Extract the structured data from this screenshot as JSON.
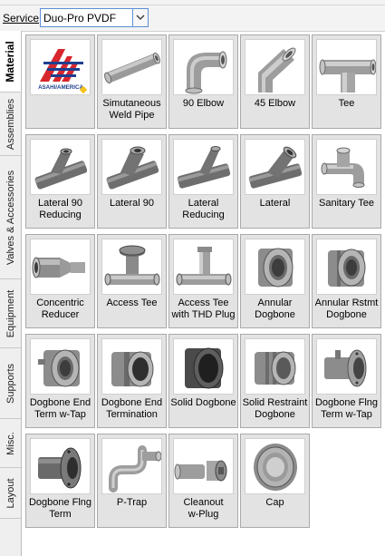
{
  "service": {
    "label": "Service",
    "value": "Duo-Pro PVDF"
  },
  "tabs": [
    "Material",
    "Assemblies",
    "Valves & Accessories",
    "Equipment",
    "Supports",
    "Misc.",
    "Layout"
  ],
  "logo": {
    "text": "ASAHI/AMERICA"
  },
  "items": [
    {
      "label": "",
      "icon": "asahi-america-logo"
    },
    {
      "label": "Simutaneous\nWeld Pipe",
      "icon": "pipe-icon"
    },
    {
      "label": "90 Elbow",
      "icon": "elbow-90-icon"
    },
    {
      "label": "45 Elbow",
      "icon": "elbow-45-icon"
    },
    {
      "label": "Tee",
      "icon": "tee-icon"
    },
    {
      "label": "Lateral 90\nReducing",
      "icon": "lateral-90-reducing-icon"
    },
    {
      "label": "Lateral 90",
      "icon": "lateral-90-icon"
    },
    {
      "label": "Lateral\nReducing",
      "icon": "lateral-reducing-icon"
    },
    {
      "label": "Lateral",
      "icon": "lateral-icon"
    },
    {
      "label": "Sanitary Tee",
      "icon": "sanitary-tee-icon"
    },
    {
      "label": "Concentric\nReducer",
      "icon": "concentric-reducer-icon"
    },
    {
      "label": "Access Tee",
      "icon": "access-tee-icon"
    },
    {
      "label": "Access Tee\nwith THD Plug",
      "icon": "access-tee-thd-plug-icon"
    },
    {
      "label": "Annular\nDogbone",
      "icon": "annular-dogbone-icon"
    },
    {
      "label": "Annular Rstmt\nDogbone",
      "icon": "annular-restraint-dogbone-icon"
    },
    {
      "label": "Dogbone End\nTerm w-Tap",
      "icon": "dogbone-end-term-tap-icon"
    },
    {
      "label": "Dogbone End\nTermination",
      "icon": "dogbone-end-termination-icon"
    },
    {
      "label": "Solid Dogbone",
      "icon": "solid-dogbone-icon"
    },
    {
      "label": "Solid Restraint\nDogbone",
      "icon": "solid-restraint-dogbone-icon"
    },
    {
      "label": "Dogbone Flng\nTerm w-Tap",
      "icon": "dogbone-flange-term-tap-icon"
    },
    {
      "label": "Dogbone Flng\nTerm",
      "icon": "dogbone-flange-term-icon"
    },
    {
      "label": "P-Trap",
      "icon": "p-trap-icon"
    },
    {
      "label": "Cleanout\nw-Plug",
      "icon": "cleanout-plug-icon"
    },
    {
      "label": "Cap",
      "icon": "cap-icon"
    }
  ],
  "colors": {
    "tile_bg": "#e3e3e3",
    "logo_red": "#d7262e",
    "logo_blue": "#1f3f8f",
    "part_gray": "#8a8a8a"
  }
}
